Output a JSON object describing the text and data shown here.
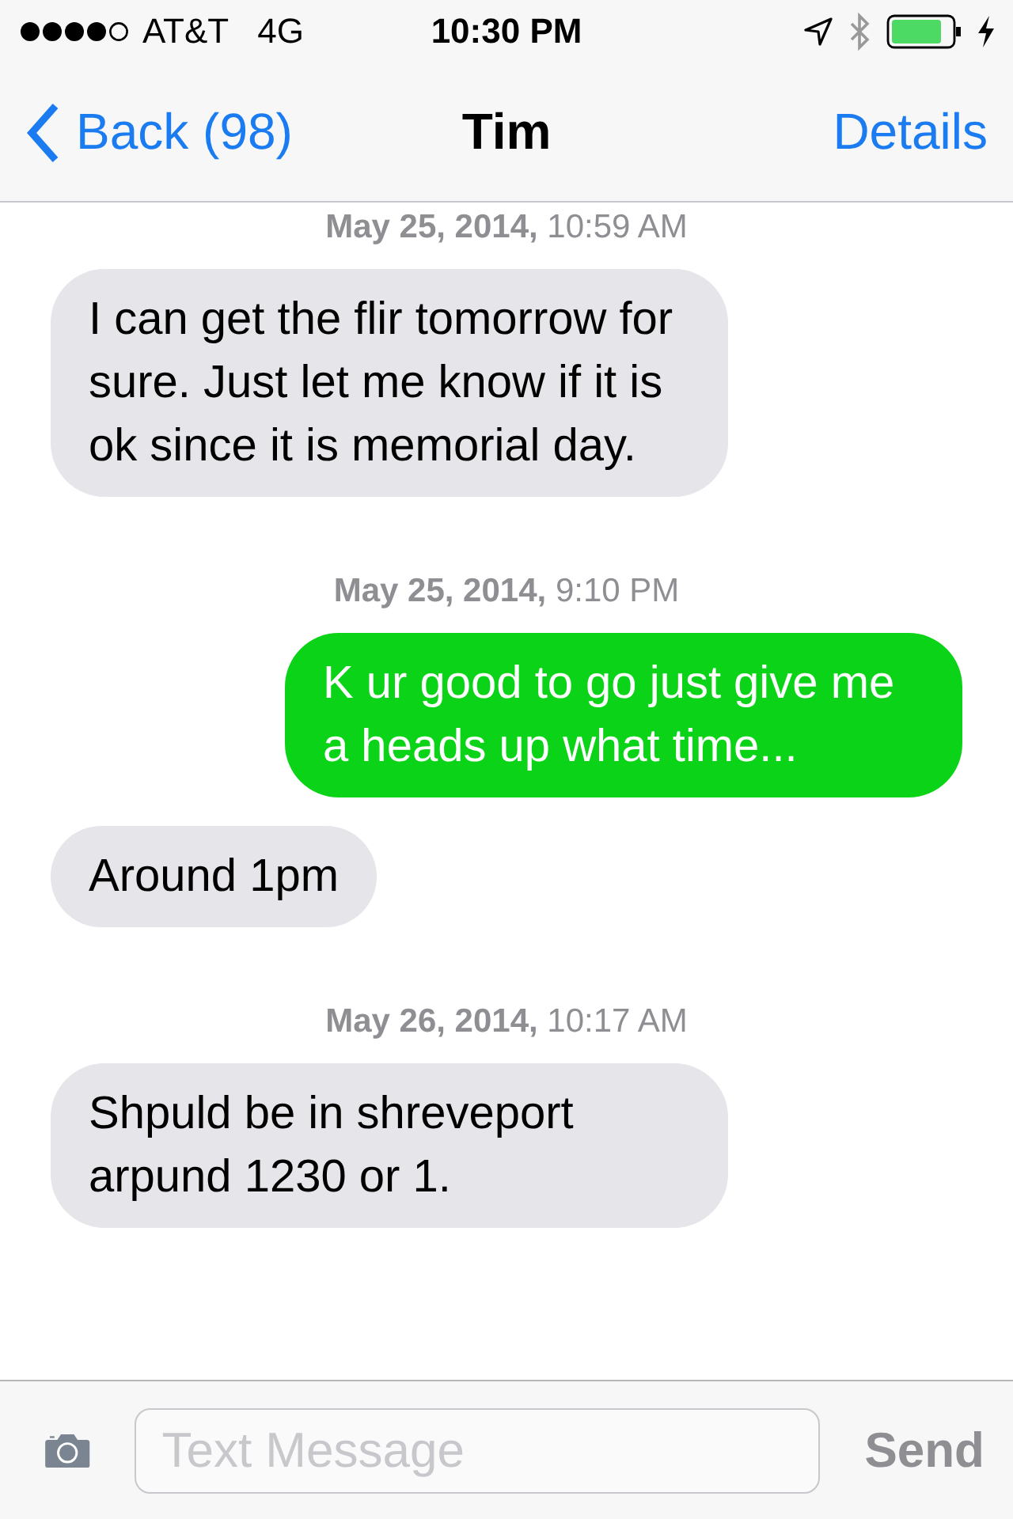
{
  "status_bar": {
    "carrier": "AT&T",
    "network": "4G",
    "time": "10:30 PM"
  },
  "nav": {
    "back": "Back (98)",
    "title": "Tim",
    "details": "Details"
  },
  "messages": [
    {
      "kind": "timestamp",
      "text": "**May 25, 2014,** 10:59 AM"
    },
    {
      "kind": "received",
      "text": "I can get the flir tomorrow for sure. Just let me know if it is ok since it is memorial day."
    },
    {
      "kind": "timestamp",
      "text": "**May 25, 2014,** 9:10 PM"
    },
    {
      "kind": "sent",
      "text": "K ur good to go just give me a heads up what time..."
    },
    {
      "kind": "received",
      "text": "Around 1pm"
    },
    {
      "kind": "timestamp",
      "text": "**May 26, 2014,** 10:17 AM"
    },
    {
      "kind": "received",
      "text": "Shpuld be in shreveport arpund 1230 or 1."
    }
  ],
  "composer": {
    "placeholder": "Text Message",
    "send": "Send"
  }
}
